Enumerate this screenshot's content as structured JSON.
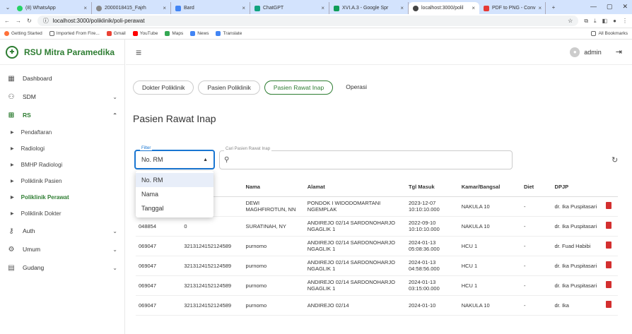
{
  "browser": {
    "tabs": [
      {
        "label": "(8) WhatsApp",
        "color": "#25d366"
      },
      {
        "label": "2000018415_Fajrh",
        "color": "#555"
      },
      {
        "label": "Bard",
        "color": "#4285f4"
      },
      {
        "label": "ChatGPT",
        "color": "#10a37f"
      },
      {
        "label": "XVI.A.3 - Google Spr",
        "color": "#0f9d58"
      },
      {
        "label": "localhost:3000/polil",
        "color": "#444"
      },
      {
        "label": "PDF to PNG - Conv",
        "color": "#e53935"
      }
    ],
    "url": "localhost:3000/poliklinik/poli-perawat",
    "bookmarks": [
      {
        "label": "Getting Started",
        "color": "#ff7139"
      },
      {
        "label": "Imported From Fire...",
        "color": "#666"
      },
      {
        "label": "Gmail",
        "color": "#ea4335"
      },
      {
        "label": "YouTube",
        "color": "#ff0000"
      },
      {
        "label": "Maps",
        "color": "#34a853"
      },
      {
        "label": "News",
        "color": "#4285f4"
      },
      {
        "label": "Translate",
        "color": "#4285f4"
      }
    ],
    "all_bookmarks": "All Bookmarks"
  },
  "brand": {
    "name": "RSU Mitra Paramedika"
  },
  "user": {
    "name": "admin"
  },
  "sidebar": {
    "items": [
      {
        "label": "Dashboard",
        "icon": "grid-icon"
      },
      {
        "label": "SDM",
        "icon": "people-icon"
      },
      {
        "label": "RS",
        "icon": "plus-icon"
      }
    ],
    "sub": [
      "Pendaftaran",
      "Radiologi",
      "BMHP Radiologi",
      "Poliklinik Pasien",
      "Poliklinik Perawat",
      "Poliklinik Dokter"
    ],
    "bottom": [
      {
        "label": "Auth",
        "icon": "key-icon"
      },
      {
        "label": "Umum",
        "icon": "gear-icon"
      },
      {
        "label": "Gudang",
        "icon": "warehouse-icon"
      }
    ]
  },
  "crumbs": [
    "Dokter Poliklinik",
    "Pasien Poliklinik",
    "Pasien Rawat Inap",
    "Operasi"
  ],
  "page": {
    "title": "Pasien Rawat Inap"
  },
  "filter": {
    "label": "Filter",
    "value": "No. RM",
    "options": [
      "No. RM",
      "Nama",
      "Tanggal"
    ]
  },
  "search": {
    "label": "Cari Pasien Rawat Inap"
  },
  "table": {
    "headers": [
      "",
      "",
      "Nama",
      "Alamat",
      "Tgl Masuk",
      "Kamar/Bangsal",
      "Diet",
      "DPJP",
      ""
    ],
    "rows": [
      {
        "rm": "",
        "nik": "",
        "nama": "DEWI MAGHFIROTUN, NN",
        "alamat": "PONDOK I WIDODOMARTANI NGEMPLAK",
        "tgl": "2023-12-07 10:10:10.000",
        "kamar": "NAKULA 10",
        "diet": "-",
        "dpjp": "dr. Ika Puspitasari"
      },
      {
        "rm": "048854",
        "nik": "0",
        "nama": "SURATINAH, NY",
        "alamat": "ANDIREJO 02/14 SARDONOHARJO NGAGLIK 1",
        "tgl": "2022-09-10 10:10:10.000",
        "kamar": "NAKULA 10",
        "diet": "-",
        "dpjp": "dr. Ika Puspitasari"
      },
      {
        "rm": "069047",
        "nik": "3213124152124589",
        "nama": "purnomo",
        "alamat": "ANDIREJO 02/14 SARDONOHARJO NGAGLIK 1",
        "tgl": "2024-01-13 05:08:36.000",
        "kamar": "HCU 1",
        "diet": "-",
        "dpjp": "dr. Fuad Habibi"
      },
      {
        "rm": "069047",
        "nik": "3213124152124589",
        "nama": "purnomo",
        "alamat": "ANDIREJO 02/14 SARDONOHARJO NGAGLIK 1",
        "tgl": "2024-01-13 04:58:56.000",
        "kamar": "HCU 1",
        "diet": "-",
        "dpjp": "dr. Ika Puspitasari"
      },
      {
        "rm": "069047",
        "nik": "3213124152124589",
        "nama": "purnomo",
        "alamat": "ANDIREJO 02/14 SARDONOHARJO NGAGLIK 1",
        "tgl": "2024-01-13 03:15:00.000",
        "kamar": "HCU 1",
        "diet": "-",
        "dpjp": "dr. Ika Puspitasari"
      },
      {
        "rm": "069047",
        "nik": "3213124152124589",
        "nama": "purnomo",
        "alamat": "ANDIREJO 02/14",
        "tgl": "2024-01-10",
        "kamar": "NAKULA 10",
        "diet": "-",
        "dpjp": "dr. Ika"
      }
    ]
  }
}
